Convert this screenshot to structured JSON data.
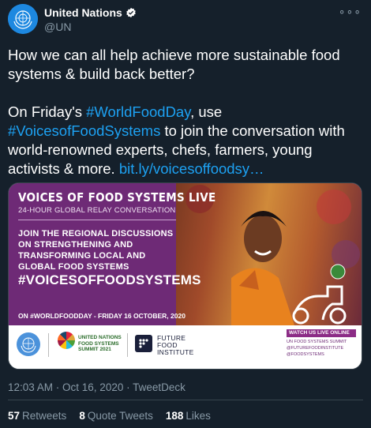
{
  "account": {
    "display_name": "United Nations",
    "handle": "@UN",
    "more_icon": "more-options-icon"
  },
  "tweet": {
    "line1": "How we can all help achieve more sustainable food systems & build back better?",
    "line2_prefix": "On Friday's ",
    "hashtag1": "#WorldFoodDay",
    "line2_mid": ", use ",
    "hashtag2": "#VoicesofFoodSystems",
    "line2_rest": " to join the conversation with world-renowned experts, chefs, farmers, young activists & more. ",
    "link": "bit.ly/voicesoffoodsy…"
  },
  "media": {
    "title": "VOICES OF FOOD SYSTEMS LIVE",
    "subtitle": "24-HOUR GLOBAL RELAY CONVERSATION",
    "join": "JOIN THE REGIONAL DISCUSSIONS ON STRENGTHENING AND TRANSFORMING LOCAL AND GLOBAL FOOD SYSTEMS",
    "hashtag": "#VOICESOFFOODSYSTEMS",
    "date": "ON #WORLDFOODDAY - FRIDAY 16 OCTOBER, 2020",
    "fss_text": "UNITED NATIONS FOOD SYSTEMS SUMMIT 2021",
    "ffi_text": "FUTURE FOOD INSTITUTE",
    "watch_title": "WATCH US LIVE ONLINE",
    "watch_items": [
      "UN FOOD SYSTEMS SUMMIT",
      "@FUTUREFOODINSTITUTE",
      "@FOODSYSTEMS"
    ]
  },
  "meta": {
    "timestamp": "12:03 AM · Oct 16, 2020 · TweetDeck"
  },
  "stats": {
    "retweets_count": "57",
    "retweets_label": "Retweets",
    "quotes_count": "8",
    "quotes_label": "Quote Tweets",
    "likes_count": "188",
    "likes_label": "Likes"
  },
  "colors": {
    "background": "#15202b",
    "link": "#1da1f2",
    "secondary_text": "#8899a6",
    "banner_purple": "#6e2a76"
  }
}
